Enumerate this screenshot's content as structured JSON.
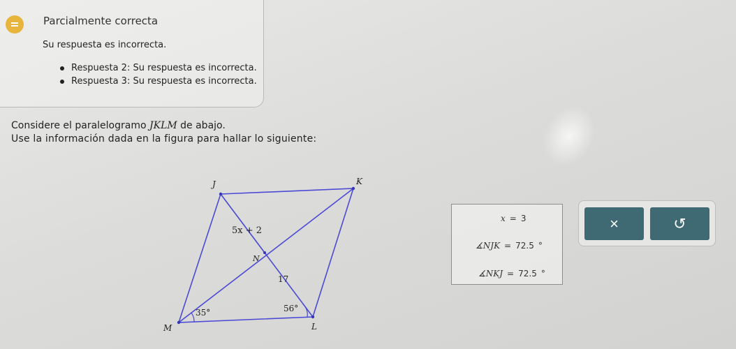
{
  "feedback": {
    "status": "Parcialmente correcta",
    "message": "Su respuesta es incorrecta.",
    "items": [
      "Respuesta 2: Su respuesta es incorrecta.",
      "Respuesta 3: Su respuesta es incorrecta."
    ],
    "icon": "equals-icon",
    "icon_color": "#e7b53c"
  },
  "prompt": {
    "line1_pre": "Considere el paralelogramo ",
    "line1_name": "JKLM",
    "line1_post": " de abajo.",
    "line2": "Use la información dada en la figura para hallar lo siguiente:"
  },
  "figure": {
    "vertex_j": "J",
    "vertex_k": "K",
    "vertex_l": "L",
    "vertex_m": "M",
    "point_n": "N",
    "label_jn": "5x + 2",
    "label_nl": "17",
    "angle_m": "35°",
    "angle_l": "56°",
    "line_color": "#4a4ad6"
  },
  "answers": {
    "x_var": "x",
    "x_eq": "=",
    "x_value": "3",
    "njk_angle": "∡NJK",
    "njk_eq": "=",
    "njk_value": "72.5",
    "njk_unit": "°",
    "nkj_angle": "∡NKJ",
    "nkj_eq": "=",
    "nkj_value": "72.5",
    "nkj_unit": "°"
  },
  "buttons": {
    "clear_icon": "close-icon",
    "clear_glyph": "×",
    "undo_icon": "undo-icon",
    "undo_glyph": "↺",
    "color": "#3f6a74"
  }
}
